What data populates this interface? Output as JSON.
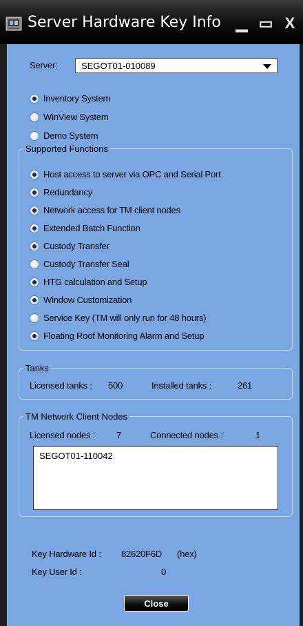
{
  "window": {
    "title": "Server Hardware Key Info"
  },
  "server": {
    "label": "Server:",
    "selected": "SEGOT01-010089"
  },
  "systems": [
    {
      "label": "Inventory System",
      "checked": true
    },
    {
      "label": "WinView System",
      "checked": false
    },
    {
      "label": "Demo System",
      "checked": false
    }
  ],
  "supported_functions": {
    "title": "Supported Functions",
    "items": [
      {
        "label": "Host access to server via OPC and Serial Port",
        "checked": true
      },
      {
        "label": "Redundancy",
        "checked": true
      },
      {
        "label": "Network access for TM client nodes",
        "checked": true
      },
      {
        "label": "Extended Batch Function",
        "checked": true
      },
      {
        "label": "Custody Transfer",
        "checked": true
      },
      {
        "label": "Custody Transfer Seal",
        "checked": false
      },
      {
        "label": "HTG calculation and Setup",
        "checked": true
      },
      {
        "label": "Window Customization",
        "checked": true
      },
      {
        "label": "Service Key (TM will only run for 48 hours)",
        "checked": false
      },
      {
        "label": "Floating Roof Monitoring Alarm and Setup",
        "checked": true
      }
    ]
  },
  "tanks": {
    "title": "Tanks",
    "licensed_label": "Licensed tanks :",
    "licensed_value": "500",
    "installed_label": "Installed tanks :",
    "installed_value": "261"
  },
  "nodes": {
    "title": "TM Network Client Nodes",
    "licensed_label": "Licensed nodes :",
    "licensed_value": "7",
    "connected_label": "Connected nodes :",
    "connected_value": "1",
    "list": [
      "SEGOT01-110042"
    ]
  },
  "key": {
    "hardware_label": "Key Hardware Id :",
    "hardware_value": "82620F6D",
    "hardware_unit": "(hex)",
    "user_label": "Key User Id :",
    "user_value": "0"
  },
  "close_label": "Close"
}
